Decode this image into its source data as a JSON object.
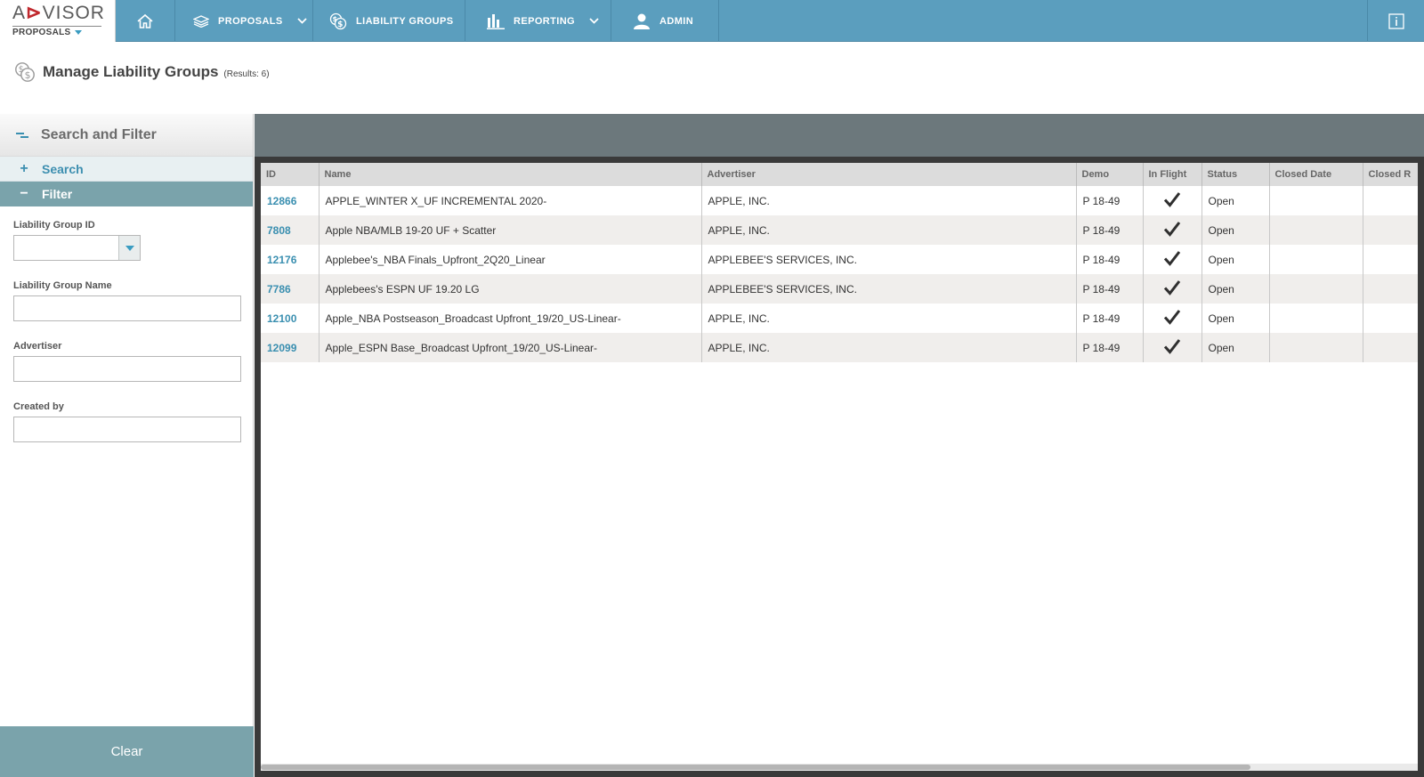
{
  "logo": {
    "word_left": "A",
    "word_mid": "D",
    "word_right": "VISOR",
    "subtitle": "PROPOSALS"
  },
  "nav": {
    "proposals": "PROPOSALS",
    "liability_groups": "LIABILITY GROUPS",
    "reporting": "REPORTING",
    "admin": "ADMIN"
  },
  "page": {
    "title": "Manage Liability Groups",
    "count": "(Results: 6)"
  },
  "sidebar": {
    "header": "Search and Filter",
    "search": {
      "sign": "+",
      "label": "Search"
    },
    "filter": {
      "sign": "−",
      "label": "Filter"
    },
    "fields": {
      "group_id": "Liability Group ID",
      "group_name": "Liability Group Name",
      "advertiser": "Advertiser",
      "created_by": "Created by"
    },
    "clear": "Clear"
  },
  "grid": {
    "columns": [
      "ID",
      "Name",
      "Advertiser",
      "Demo",
      "In Flight",
      "Status",
      "Closed Date",
      "Closed R"
    ],
    "rows": [
      {
        "id": "12866",
        "name": "APPLE_WINTER X_UF INCREMENTAL 2020-",
        "advertiser": "APPLE, INC.",
        "demo": "P 18-49",
        "in_flight": true,
        "status": "Open",
        "closed_date": "",
        "closed_r": ""
      },
      {
        "id": "7808",
        "name": "Apple NBA/MLB 19-20 UF + Scatter",
        "advertiser": "APPLE, INC.",
        "demo": "P 18-49",
        "in_flight": true,
        "status": "Open",
        "closed_date": "",
        "closed_r": ""
      },
      {
        "id": "12176",
        "name": "Applebee's_NBA Finals_Upfront_2Q20_Linear",
        "advertiser": "APPLEBEE'S SERVICES, INC.",
        "demo": "P 18-49",
        "in_flight": true,
        "status": "Open",
        "closed_date": "",
        "closed_r": ""
      },
      {
        "id": "7786",
        "name": "Applebees's ESPN UF 19.20 LG",
        "advertiser": "APPLEBEE'S SERVICES, INC.",
        "demo": "P 18-49",
        "in_flight": true,
        "status": "Open",
        "closed_date": "",
        "closed_r": ""
      },
      {
        "id": "12100",
        "name": "Apple_NBA Postseason_Broadcast Upfront_19/20_US-Linear-",
        "advertiser": "APPLE, INC.",
        "demo": "P 18-49",
        "in_flight": true,
        "status": "Open",
        "closed_date": "",
        "closed_r": ""
      },
      {
        "id": "12099",
        "name": "Apple_ESPN Base_Broadcast Upfront_19/20_US-Linear-",
        "advertiser": "APPLE, INC.",
        "demo": "P 18-49",
        "in_flight": true,
        "status": "Open",
        "closed_date": "",
        "closed_r": ""
      }
    ]
  },
  "colors": {
    "nav_bg": "#5b9ebe",
    "accent": "#3a8fb0",
    "filter_bg": "#7aa3ab",
    "grid_top": "#6c787c"
  },
  "icons": {
    "home": "home-icon",
    "proposals": "layers-icon",
    "liability": "coins-icon",
    "reporting": "bar-chart-icon",
    "admin": "user-icon",
    "info": "info-icon",
    "check": "checkmark-icon"
  }
}
